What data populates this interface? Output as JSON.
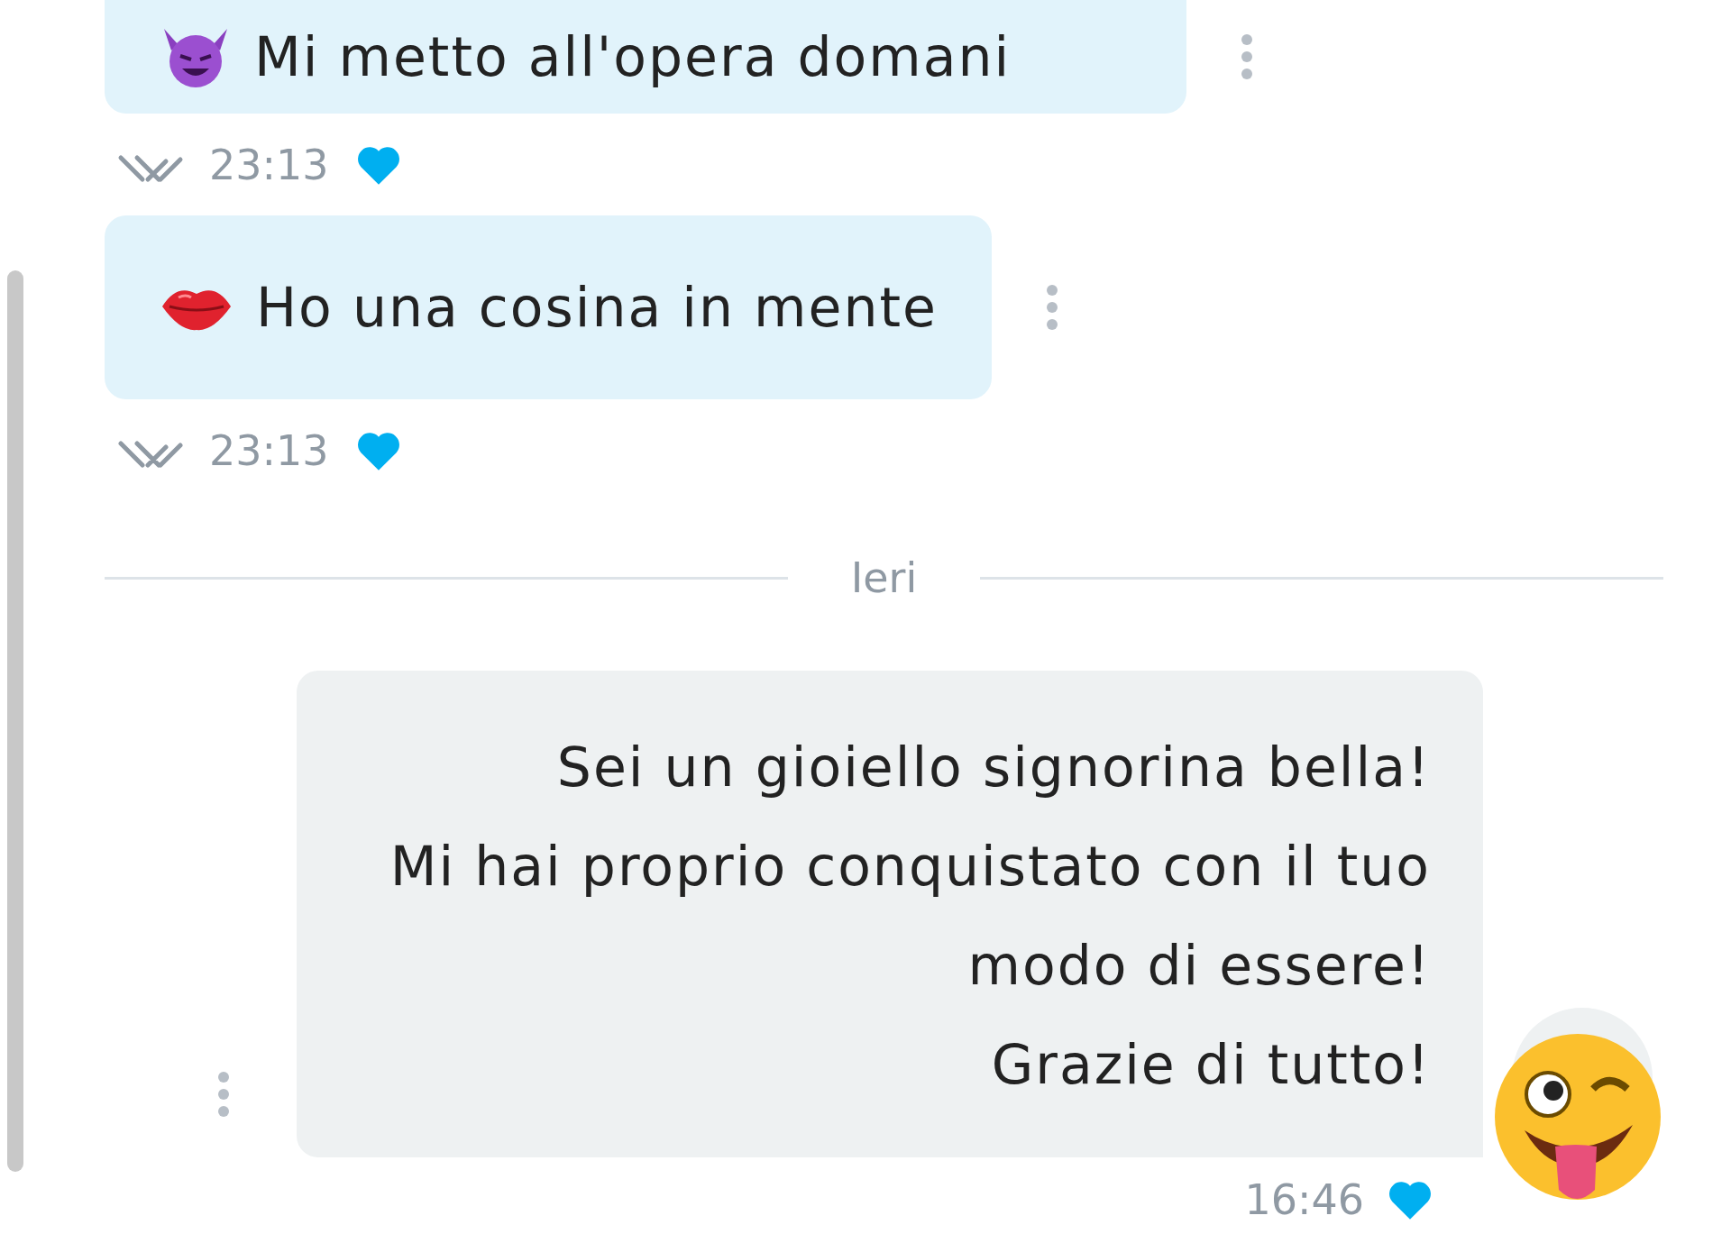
{
  "messages": [
    {
      "kind": "outgoing",
      "text": "Mi metto all'opera domani",
      "emoji": {
        "kind": "devil"
      },
      "time": "23:13",
      "liked": true,
      "read": true
    },
    {
      "kind": "outgoing",
      "text": "Ho una cosina in mente",
      "emoji": {
        "kind": "kiss"
      },
      "time": "23:13",
      "liked": true,
      "read": true
    },
    {
      "kind": "divider",
      "label": "Ieri"
    },
    {
      "kind": "incoming",
      "lines": [
        "Sei un gioiello signorina bella!",
        "Mi hai proprio conquistato con il tuo modo di essere!",
        "Grazie di tutto!"
      ],
      "emoji": {
        "kind": "wink"
      },
      "time": "16:46",
      "liked": true
    }
  ]
}
